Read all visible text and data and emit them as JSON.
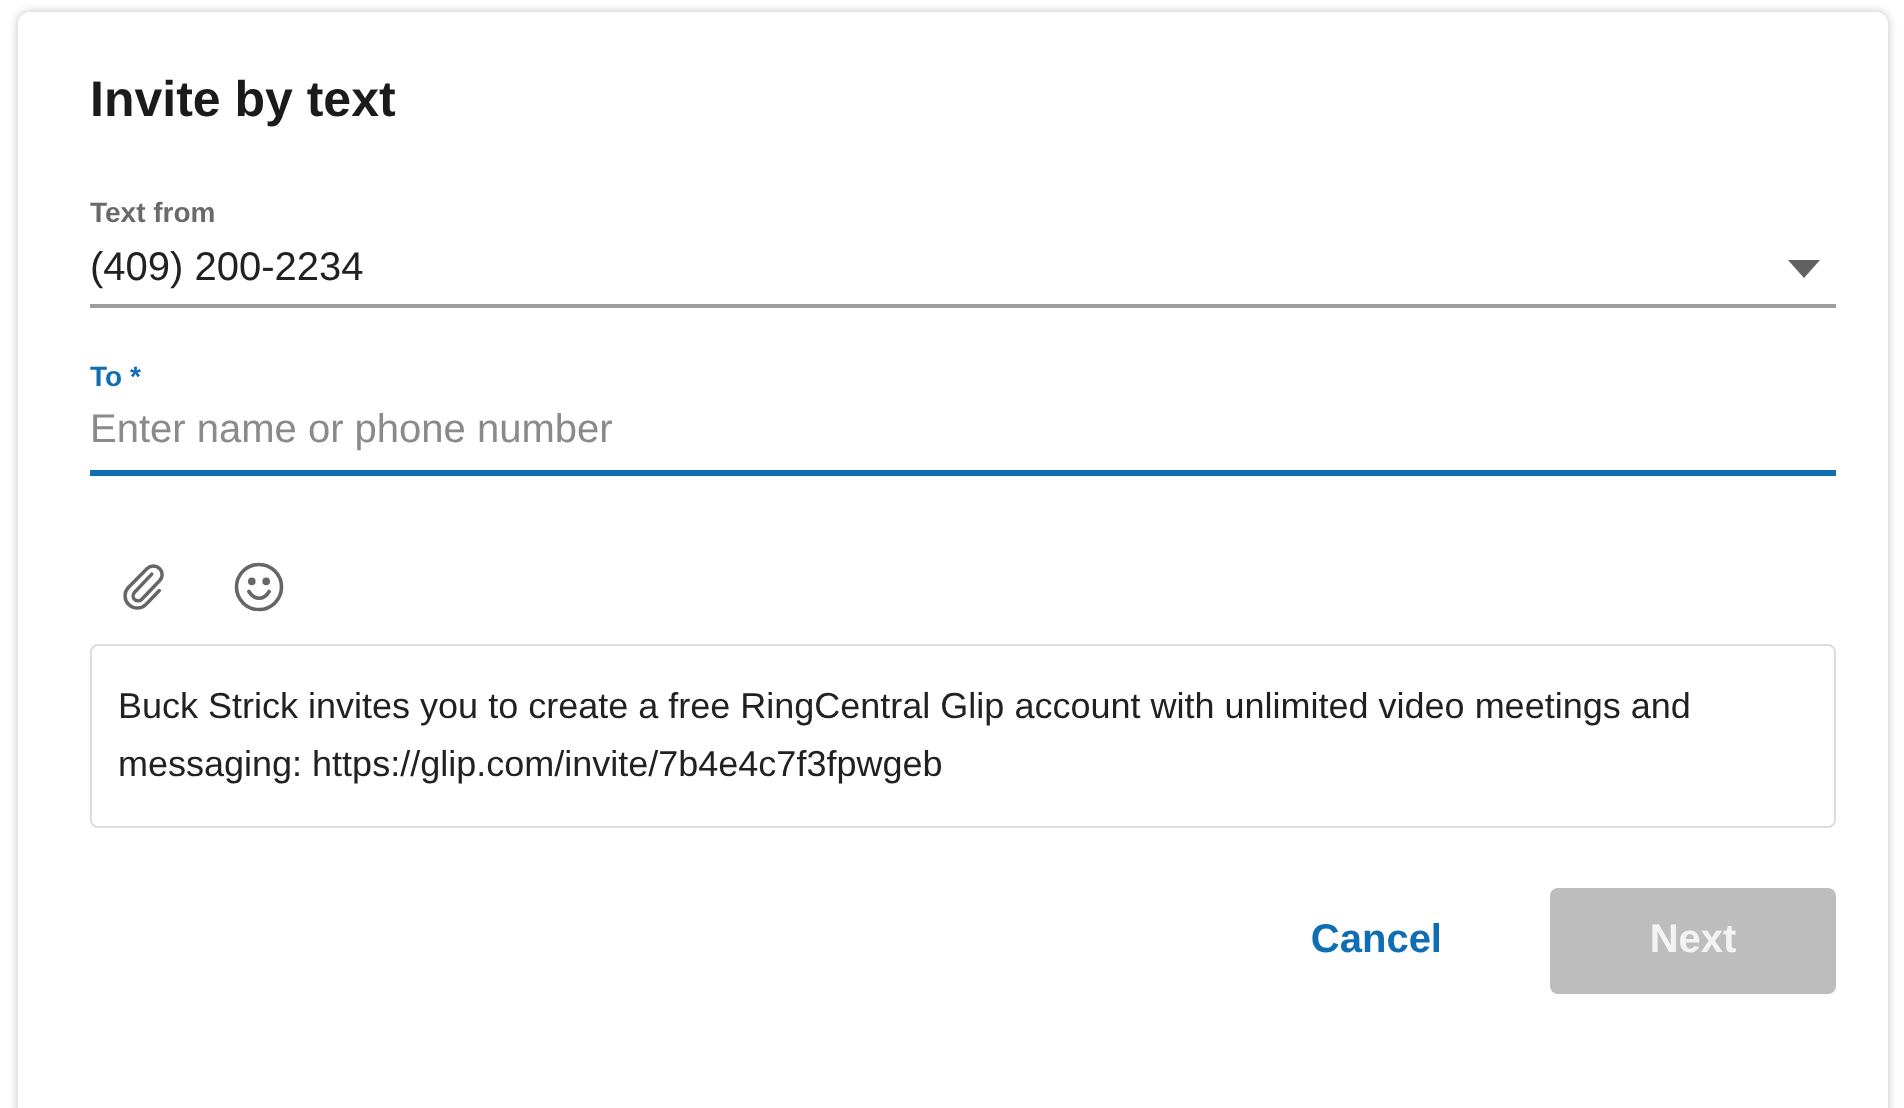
{
  "dialog": {
    "title": "Invite by text"
  },
  "text_from": {
    "label": "Text from",
    "value": "(409) 200-2234"
  },
  "to": {
    "label": "To *",
    "placeholder": "Enter name or phone number",
    "focused": true
  },
  "message": {
    "value": "Buck Strick invites you to create a free RingCentral Glip account with unlimited video meetings and messaging: https://glip.com/invite/7b4e4c7f3fpwgeb"
  },
  "buttons": [
    {
      "kind": "text",
      "label": "Cancel",
      "disabled": false
    },
    {
      "kind": "filled",
      "label": "Next",
      "disabled": true
    }
  ]
}
